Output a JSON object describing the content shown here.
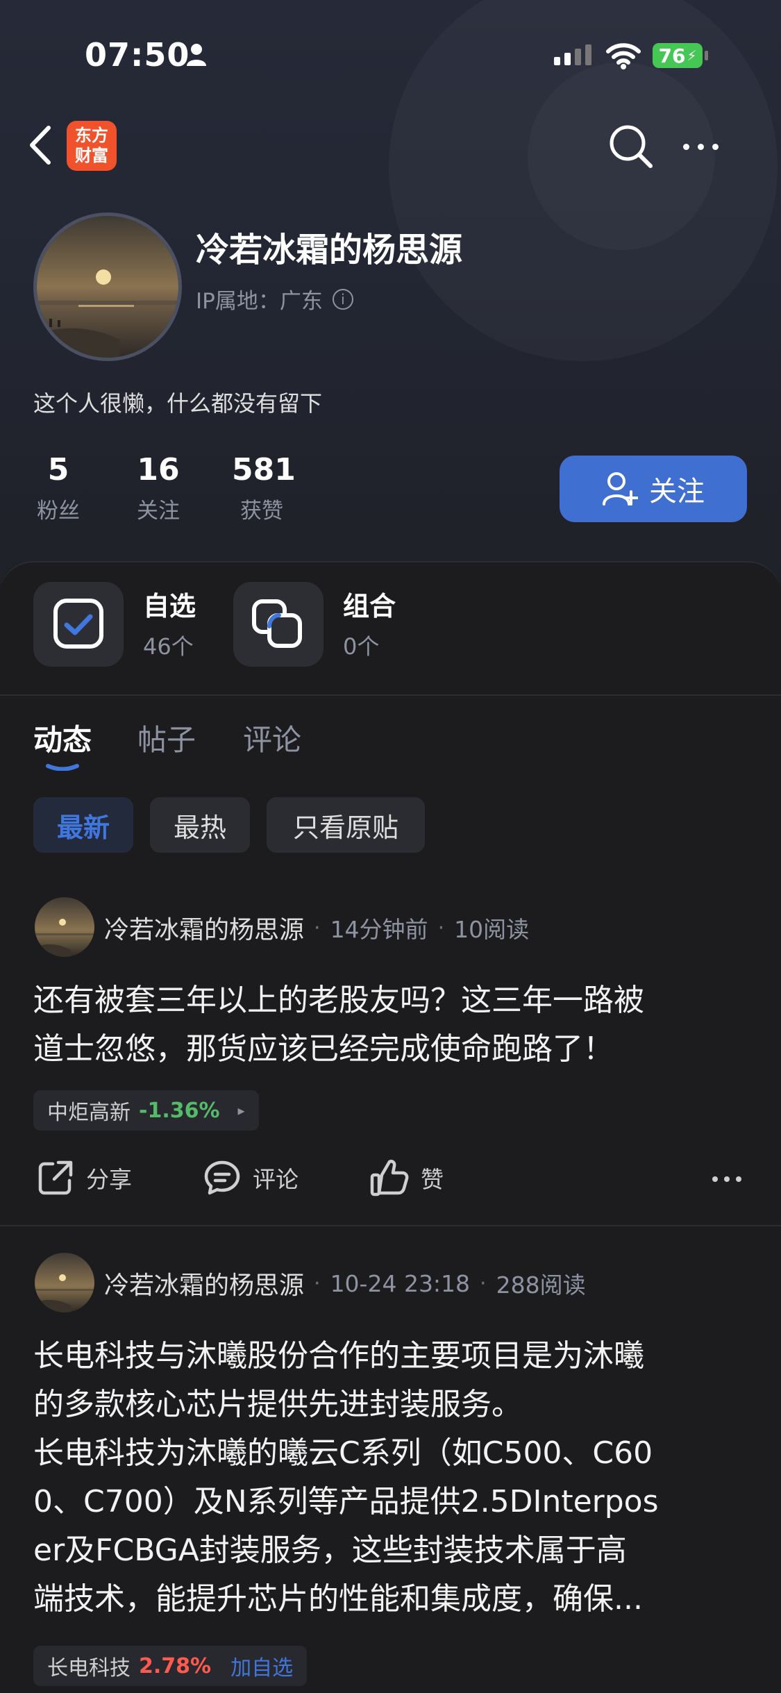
{
  "status_bar": {
    "time": "07:50",
    "battery": "76"
  },
  "profile": {
    "app_logo_lines": [
      "东方",
      "财富"
    ],
    "username": "冷若冰霜的杨思源",
    "ip_location": "IP属地：广东",
    "bio": "这个人很懒，什么都没有留下",
    "stats": [
      {
        "value": "5",
        "label": "粉丝"
      },
      {
        "value": "16",
        "label": "关注"
      },
      {
        "value": "581",
        "label": "获赞"
      }
    ],
    "follow_label": "关注"
  },
  "tiles": [
    {
      "title": "自选",
      "count": "46个"
    },
    {
      "title": "组合",
      "count": "0个"
    }
  ],
  "tabs": [
    "动态",
    "帖子",
    "评论"
  ],
  "filters": [
    "最新",
    "最热",
    "只看原贴"
  ],
  "posts": [
    {
      "author": "冷若冰霜的杨思源",
      "time": "14分钟前",
      "reads": "10阅读",
      "lines": [
        "还有被套三年以上的老股友吗？这三年一路被",
        "道士忽悠，那货应该已经完成使命跑路了！"
      ],
      "stock": {
        "name": "中炬高新",
        "change": "-1.36%",
        "arrow": "▸"
      }
    },
    {
      "author": "冷若冰霜的杨思源",
      "time": "10-24 23:18",
      "reads": "288阅读",
      "lines": [
        "长电科技与沐曦股份合作的主要项目是为沐曦",
        "的多款核心芯片提供先进封装服务。",
        "长电科技为沐曦的曦云C系列（如C500、C60",
        "0、C700）及N系列等产品提供2.5DInterpos",
        "er及FCBGA封装服务，这些封装技术属于高",
        "端技术，能提升芯片的性能和集成度，确保..."
      ],
      "stock": {
        "name": "长电科技",
        "change": "2.78%",
        "add_label": "加自选"
      }
    }
  ],
  "actions": {
    "share": "分享",
    "comment": "评论",
    "like": "赞"
  }
}
